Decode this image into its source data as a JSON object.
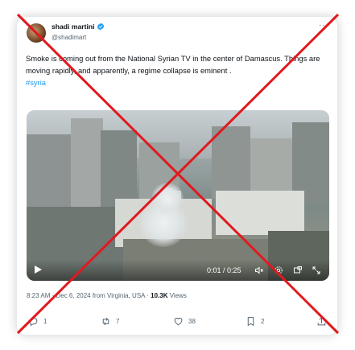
{
  "author": {
    "name": "shadi martini",
    "handle": "@shadimart",
    "verified": true
  },
  "more_icon": "ellipsis-icon",
  "tweet": {
    "text": "Smoke is coming out from the National Syrian TV in the center of Damascus. Things are moving rapidly, and apparently, a regime collapse is eminent .",
    "hashtag": "#syria"
  },
  "video": {
    "time": "0:01 / 0:25",
    "icons": [
      "play-icon",
      "mute-icon",
      "settings-icon",
      "picture-in-picture-icon",
      "fullscreen-icon"
    ]
  },
  "meta": {
    "time": "8:23 AM",
    "sep1": " · ",
    "date": "Dec 6, 2024 from Virginia, USA",
    "sep2": " · ",
    "views_count": "10.3K",
    "views_label": " Views"
  },
  "actions": {
    "replies": "1",
    "reposts": "7",
    "likes": "38",
    "bookmarks": "2"
  },
  "colors": {
    "accent": "#1d9bf0",
    "cross": "#e0191e",
    "muted": "#536471"
  }
}
